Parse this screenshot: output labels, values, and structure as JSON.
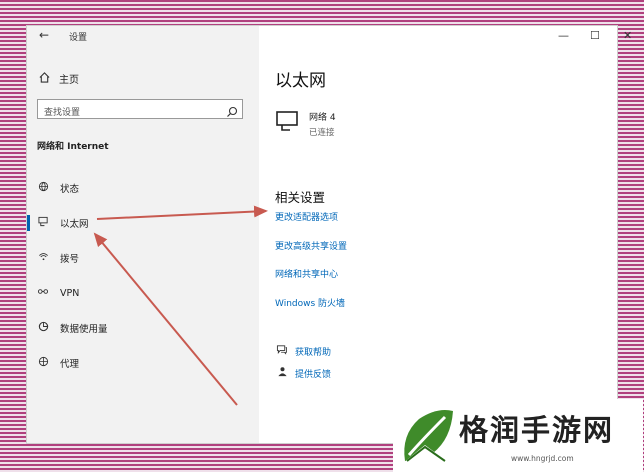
{
  "window": {
    "app_title": "设置",
    "back_glyph": "←",
    "minimize_glyph": "—",
    "maximize_glyph": "☐",
    "close_glyph": "✕"
  },
  "sidebar": {
    "home_label": "主页",
    "search_placeholder": "查找设置",
    "section_title": "网络和 Internet",
    "items": [
      {
        "label": "状态",
        "icon": "globe-status-icon"
      },
      {
        "label": "以太网",
        "icon": "ethernet-monitor-icon",
        "active": true
      },
      {
        "label": "拨号",
        "icon": "dialup-icon"
      },
      {
        "label": "VPN",
        "icon": "vpn-icon"
      },
      {
        "label": "数据使用量",
        "icon": "data-usage-icon"
      },
      {
        "label": "代理",
        "icon": "globe-proxy-icon"
      }
    ]
  },
  "main": {
    "title": "以太网",
    "network": {
      "name": "网络 4",
      "status": "已连接"
    },
    "related_title": "相关设置",
    "links": [
      "更改适配器选项",
      "更改高级共享设置",
      "网络和共享中心",
      "Windows 防火墙"
    ],
    "help": [
      {
        "label": "获取帮助",
        "icon": "help-chat-icon"
      },
      {
        "label": "提供反馈",
        "icon": "feedback-icon"
      }
    ]
  },
  "watermark": {
    "text": "格润手游网",
    "url": "www.hngrjd.com"
  },
  "colors": {
    "link": "#0067b8",
    "accent": "#0063b1",
    "arrow": "#c85a50",
    "stripe": "#b0407e",
    "logo_green": "#3f8b2a"
  }
}
